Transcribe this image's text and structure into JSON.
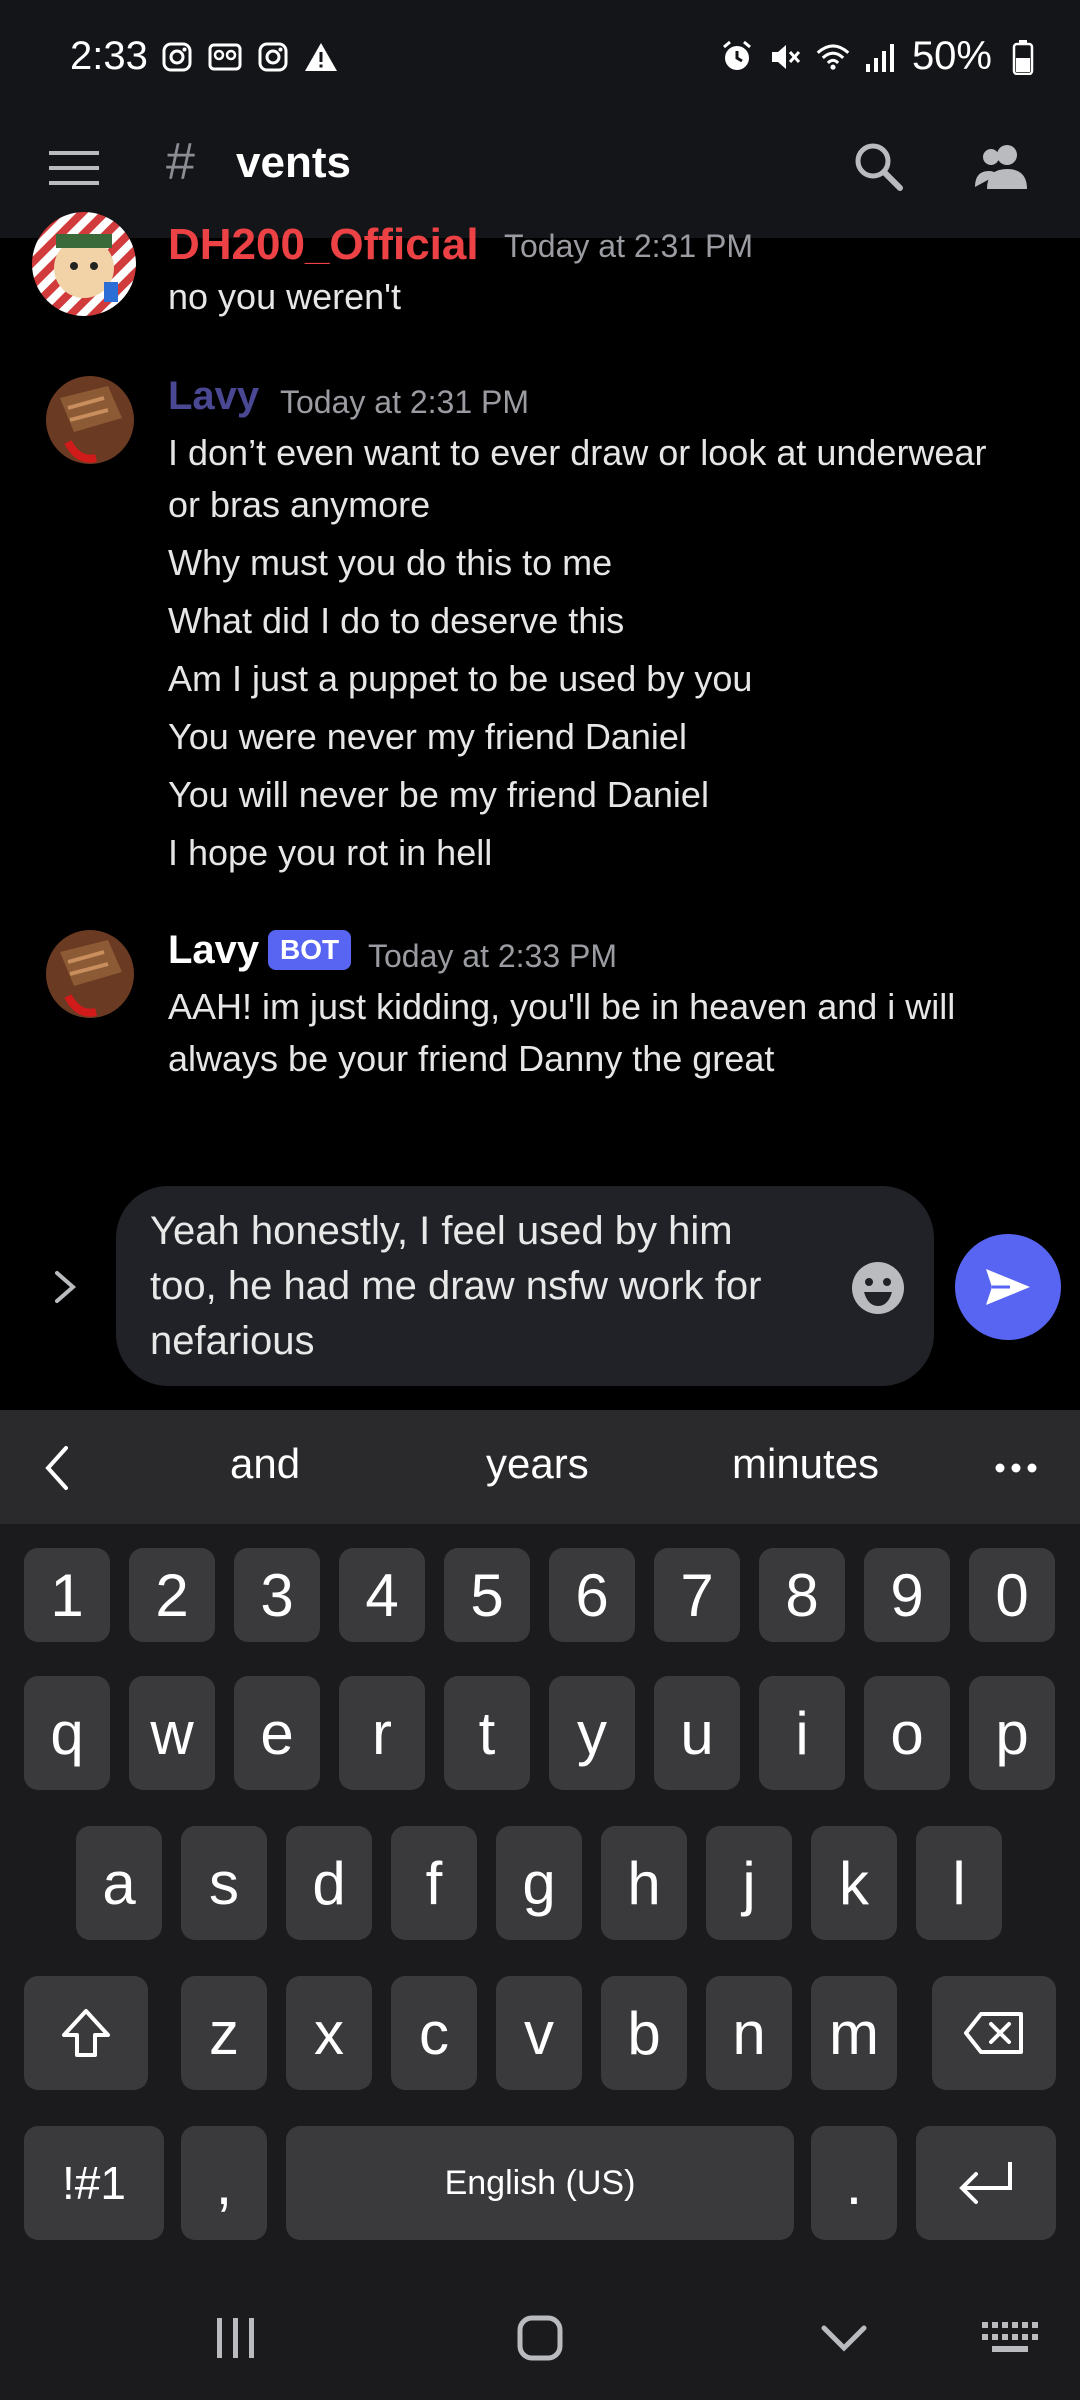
{
  "status_bar": {
    "time": "2:33",
    "battery": "50%",
    "left_icons": [
      "instagram-icon",
      "voicemail-icon",
      "instagram-icon",
      "warning-icon"
    ],
    "right_icons": [
      "alarm-icon",
      "mute-icon",
      "wifi-icon",
      "signal-icon",
      "battery-icon"
    ]
  },
  "header": {
    "hash": "#",
    "channel_name": "vents"
  },
  "messages": [
    {
      "author": "DH200_Official",
      "author_color": "#ed4245",
      "time": "Today at 2:31 PM",
      "lines": [
        "no you weren't"
      ]
    },
    {
      "author": "Lavy",
      "author_color": "#4a4793",
      "time": "Today at 2:31 PM",
      "lines": [
        "I don’t even want to ever draw or look at underwear",
        "or bras anymore",
        "Why must you do this to me",
        "What did I do to deserve this",
        "Am I just a puppet to be used by you",
        "You were never my friend Daniel",
        "You will never be my friend Daniel",
        "I hope you rot in hell"
      ]
    },
    {
      "author": "Lavy",
      "author_color": "#ffffff",
      "badge": "BOT",
      "time": "Today at 2:33 PM",
      "lines": [
        "AAH! im just kidding, you'll be in heaven and i will",
        "always be your friend Danny the great"
      ]
    }
  ],
  "composer": {
    "text_lines": [
      "Yeah honestly, I feel used by him",
      "too, he had me draw nsfw work for",
      "nefarious"
    ]
  },
  "keyboard": {
    "suggestions": [
      "and",
      "years",
      "minutes"
    ],
    "row_numbers": [
      "1",
      "2",
      "3",
      "4",
      "5",
      "6",
      "7",
      "8",
      "9",
      "0"
    ],
    "row1": [
      "q",
      "w",
      "e",
      "r",
      "t",
      "y",
      "u",
      "i",
      "o",
      "p"
    ],
    "row2": [
      "a",
      "s",
      "d",
      "f",
      "g",
      "h",
      "j",
      "k",
      "l"
    ],
    "row3": [
      "z",
      "x",
      "c",
      "v",
      "b",
      "n",
      "m"
    ],
    "symbols_key": "!#1",
    "comma_key": ",",
    "space_key": "English (US)",
    "period_key": "."
  },
  "colors": {
    "accent": "#5865f2",
    "background": "#000000",
    "header_bg": "#141518"
  }
}
